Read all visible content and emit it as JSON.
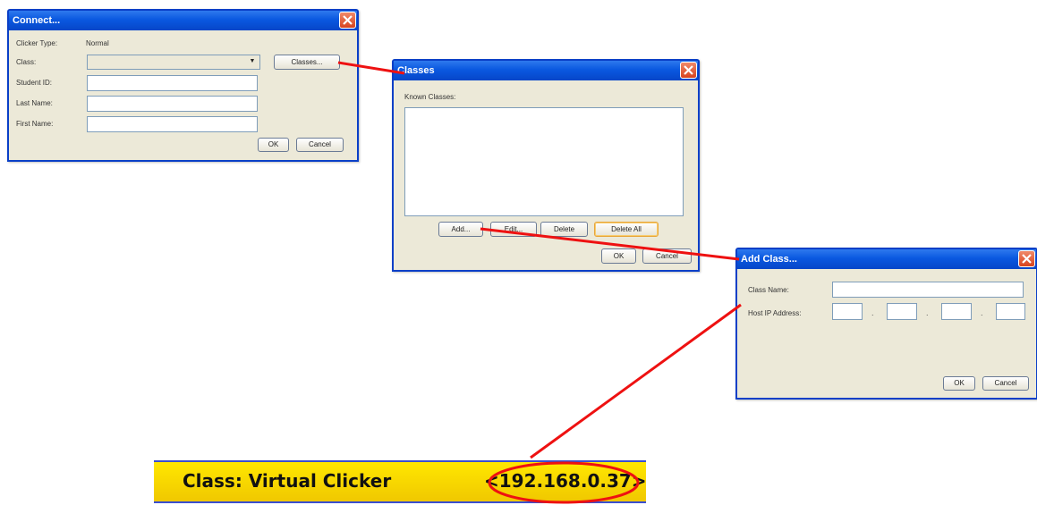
{
  "connect_dialog": {
    "title": "Connect...",
    "clicker_type_label": "Clicker Type:",
    "clicker_type_value": "Normal",
    "class_label": "Class:",
    "class_value": "",
    "classes_button": "Classes...",
    "student_id_label": "Student ID:",
    "last_name_label": "Last Name:",
    "first_name_label": "First Name:",
    "ok_button": "OK",
    "cancel_button": "Cancel"
  },
  "classes_dialog": {
    "title": "Classes",
    "known_classes_label": "Known Classes:",
    "add_button": "Add...",
    "edit_button": "Edit...",
    "delete_button": "Delete",
    "delete_all_button": "Delete All",
    "ok_button": "OK",
    "cancel_button": "Cancel"
  },
  "add_class_dialog": {
    "title": "Add Class...",
    "class_name_label": "Class Name:",
    "host_ip_label": "Host IP Address:",
    "ok_button": "OK",
    "cancel_button": "Cancel"
  },
  "status_banner": {
    "text": "Class: Virtual Clicker",
    "ip": "<192.168.0.37>"
  },
  "colors": {
    "connector_line": "#ee1111",
    "banner_bg": "#ffe700",
    "titlebar": "#0a58e0"
  }
}
